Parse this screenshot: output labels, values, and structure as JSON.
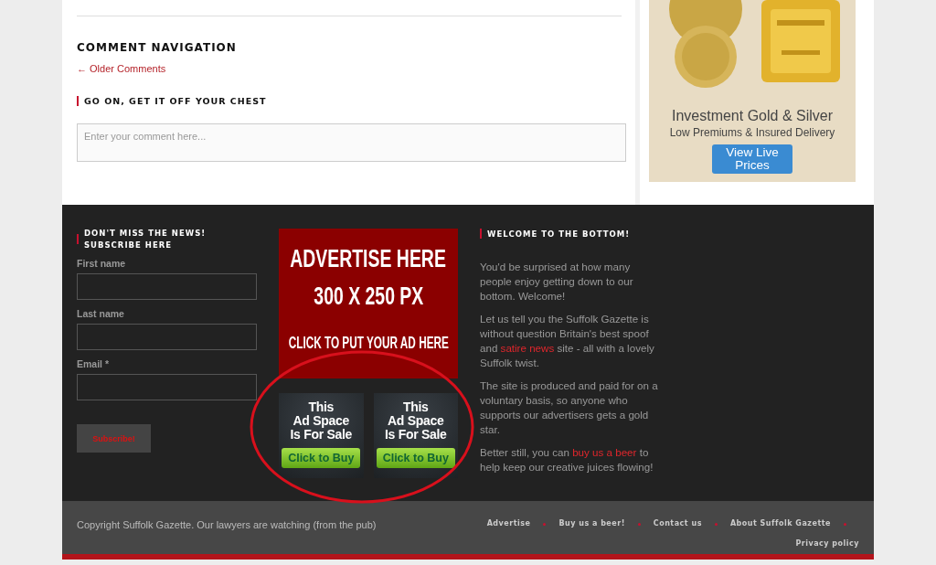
{
  "comment_navigation": {
    "title": "COMMENT NAVIGATION",
    "older_link": "← Older Comments"
  },
  "reply": {
    "title": "GO ON, GET IT OFF YOUR CHEST",
    "placeholder": "Enter your comment here..."
  },
  "sidebar_ad": {
    "heading": "Investment Gold & Silver",
    "subheading": "Low Premiums & Insured Delivery",
    "button": "View Live Prices"
  },
  "subscribe": {
    "title_lines": [
      "DON'T MISS THE NEWS!",
      "SUBSCRIBE HERE"
    ],
    "fields": [
      {
        "label": "First name"
      },
      {
        "label": "Last name"
      },
      {
        "label": "Email *"
      }
    ],
    "button": "Subscribe!"
  },
  "ad_banner": {
    "line_1": "ADVERTISE HERE",
    "line_2": "300 X 250 PX",
    "line_3": "CLICK TO PUT YOUR AD HERE"
  },
  "small_ads": [
    {
      "text_lines": [
        "This",
        "Ad Space",
        "Is For Sale"
      ],
      "button": "Click to Buy"
    },
    {
      "text_lines": [
        "This",
        "Ad Space",
        "Is For Sale"
      ],
      "button": "Click to Buy"
    }
  ],
  "welcome": {
    "title": "WELCOME TO THE BOTTOM!",
    "paragraphs": [
      [
        {
          "text": "You'd be surprised at how many people enjoy getting down to our bottom. Welcome!"
        }
      ],
      [
        {
          "text": "Let us tell you the Suffolk Gazette is without question Britain's best spoof and "
        },
        {
          "text": "satire news",
          "link": true
        },
        {
          "text": " site - all with a lovely Suffolk twist."
        }
      ],
      [
        {
          "text": "The site is produced and paid for on a voluntary basis, so anyone who supports our advertisers gets a gold star."
        }
      ],
      [
        {
          "text": "Better still, you can "
        },
        {
          "text": "buy us a beer",
          "link": true
        },
        {
          "text": " to help keep our creative juices flowing!"
        }
      ]
    ]
  },
  "bottom_bar": {
    "copyright": "Copyright Suffolk Gazette. Our lawyers are watching (from the pub)",
    "links": [
      "Advertise",
      "Buy us a beer!",
      "Contact us",
      "About Suffolk Gazette",
      "Privacy policy"
    ]
  }
}
